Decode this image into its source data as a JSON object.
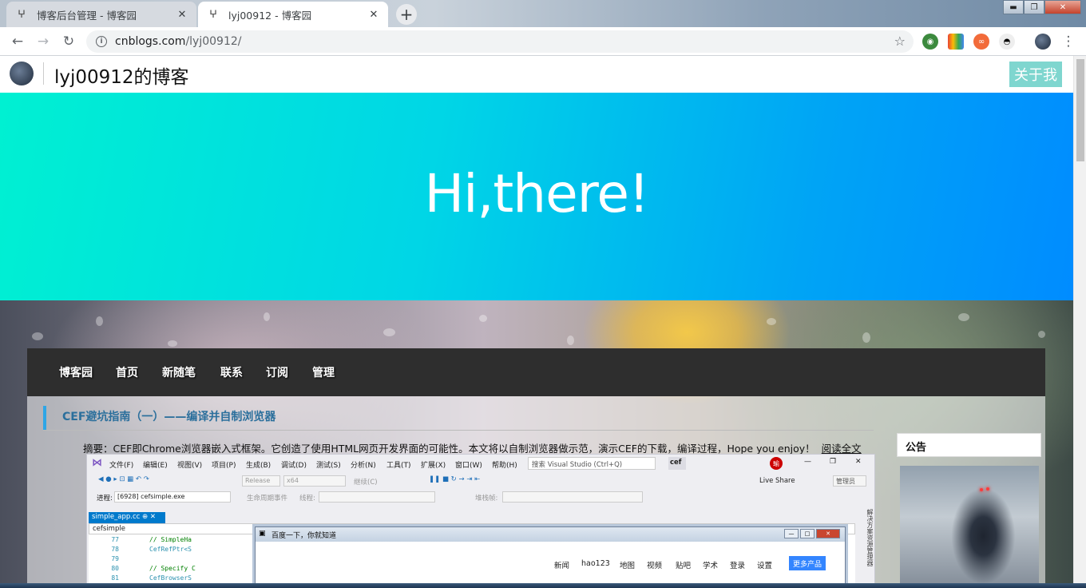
{
  "browser": {
    "tabs": [
      {
        "title": "博客后台管理 - 博客园",
        "active": false
      },
      {
        "title": "lyj00912 - 博客园",
        "active": true
      }
    ],
    "address": {
      "domain": "cnblogs.com",
      "path": "/lyj00912/"
    },
    "window_controls": {
      "minimize": "▬",
      "maximize": "❐",
      "close": "✕"
    }
  },
  "site": {
    "blog_title": "lyj00912的博客",
    "about_button": "关于我",
    "hero_text": "Hi,there!",
    "nav": [
      "博客园",
      "首页",
      "新随笔",
      "联系",
      "订阅",
      "管理"
    ],
    "post": {
      "title": "CEF避坑指南（一）——编译并自制浏览器",
      "summary": "摘要：CEF即Chrome浏览器嵌入式框架。它创造了使用HTML网页开发界面的可能性。本文将以自制浏览器做示范，演示CEF的下载，编译过程，Hope you enjoy！",
      "read_more": "阅读全文"
    },
    "sidebar": {
      "notice_title": "公告"
    }
  },
  "embedded_screenshot": {
    "vs_menu": [
      "文件(F)",
      "编辑(E)",
      "视图(V)",
      "项目(P)",
      "生成(B)",
      "调试(D)",
      "测试(S)",
      "分析(N)",
      "工具(T)",
      "扩展(X)",
      "窗口(W)",
      "帮助(H)"
    ],
    "vs_search_placeholder": "搜索 Visual Studio (Ctrl+Q)",
    "vs_project": "cef",
    "vs_config": "Release",
    "vs_platform": "x64",
    "vs_continue": "继续(C)",
    "vs_live_share": "Live Share",
    "vs_admin": "管理员",
    "vs_process_label": "进程:",
    "vs_process_value": "[6928] cefsimple.exe",
    "vs_lifecycle": "生命周期事件",
    "vs_thread_label": "线程:",
    "vs_stack_label": "堆栈帧:",
    "vs_file_tab": "simple_app.cc",
    "vs_scope": "cefsimple",
    "vs_right_panel": "解决方案资源管理器",
    "vs_lines": [
      {
        "n": "77",
        "code": "// SimpleHa"
      },
      {
        "n": "78",
        "code": "CefRefPtr<S"
      },
      {
        "n": "79",
        "code": ""
      },
      {
        "n": "80",
        "code": "// Specify C"
      },
      {
        "n": "81",
        "code": "CefBrowserS"
      }
    ],
    "baidu_title": "百度一下，你就知道",
    "baidu_links": [
      "新闻",
      "hao123",
      "地图",
      "视频",
      "贴吧",
      "学术",
      "登录",
      "设置"
    ],
    "baidu_more": "更多产品"
  }
}
